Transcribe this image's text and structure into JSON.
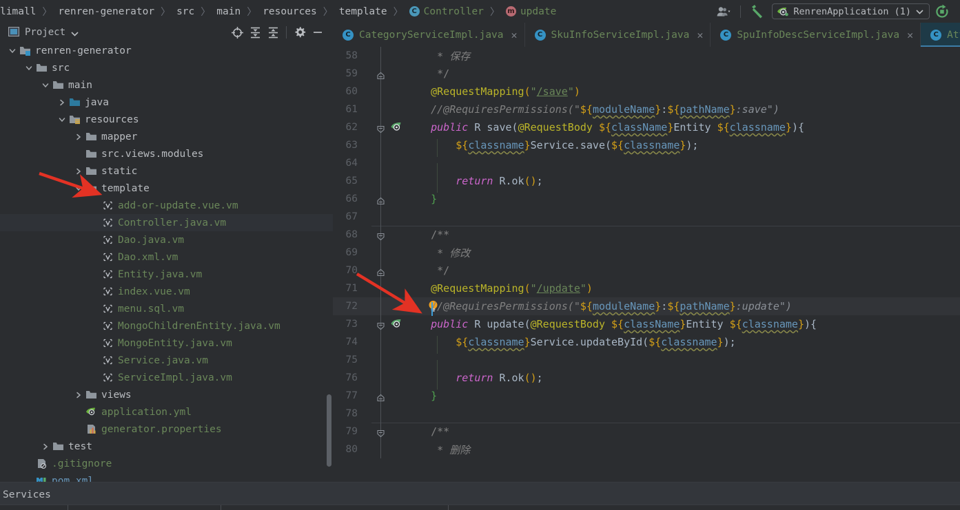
{
  "breadcrumb": [
    {
      "label": "limall",
      "type": "text"
    },
    {
      "label": "renren-generator",
      "type": "text"
    },
    {
      "label": "src",
      "type": "text"
    },
    {
      "label": "main",
      "type": "text"
    },
    {
      "label": "resources",
      "type": "text"
    },
    {
      "label": "template",
      "type": "text"
    },
    {
      "label": "Controller",
      "type": "class",
      "badge": "C"
    },
    {
      "label": "update",
      "type": "method",
      "badge": "m"
    }
  ],
  "toolbar": {
    "user_icon": "user-account-icon",
    "build_icon": "build-hammer-icon",
    "run_config": "RenrenApplication (1)",
    "run_config_icon": "spring-boot-leaf-icon",
    "dropdown_icon": "chevron-down-icon",
    "rerun_icon": "rerun-icon"
  },
  "project_panel": {
    "title": "Project",
    "dropdown_icon": "chevron-down-icon",
    "window_icon": "project-window-icon",
    "tools": [
      "locate-target-icon",
      "expand-all-icon",
      "collapse-all-icon",
      "settings-gear-icon",
      "minimize-icon"
    ]
  },
  "tree": [
    {
      "label": "renren-generator",
      "indent": 1,
      "arrow": "down",
      "icon": "module-folder",
      "color": "default"
    },
    {
      "label": "src",
      "indent": 2,
      "arrow": "down",
      "icon": "folder",
      "color": "default"
    },
    {
      "label": "main",
      "indent": 3,
      "arrow": "down",
      "icon": "folder",
      "color": "default"
    },
    {
      "label": "java",
      "indent": 4,
      "arrow": "right",
      "icon": "folder-source",
      "color": "default"
    },
    {
      "label": "resources",
      "indent": 4,
      "arrow": "down",
      "icon": "folder-resource",
      "color": "default"
    },
    {
      "label": "mapper",
      "indent": 5,
      "arrow": "right",
      "icon": "folder",
      "color": "default"
    },
    {
      "label": "src.views.modules",
      "indent": 5,
      "arrow": "none",
      "icon": "folder",
      "color": "default"
    },
    {
      "label": "static",
      "indent": 5,
      "arrow": "right",
      "icon": "folder",
      "color": "default"
    },
    {
      "label": "template",
      "indent": 5,
      "arrow": "down",
      "icon": "folder",
      "color": "default"
    },
    {
      "label": "add-or-update.vue.vm",
      "indent": 6,
      "arrow": "none",
      "icon": "velocity-file",
      "color": "green"
    },
    {
      "label": "Controller.java.vm",
      "indent": 6,
      "arrow": "none",
      "icon": "velocity-file",
      "color": "green",
      "selected": true
    },
    {
      "label": "Dao.java.vm",
      "indent": 6,
      "arrow": "none",
      "icon": "velocity-file",
      "color": "green"
    },
    {
      "label": "Dao.xml.vm",
      "indent": 6,
      "arrow": "none",
      "icon": "velocity-file",
      "color": "green"
    },
    {
      "label": "Entity.java.vm",
      "indent": 6,
      "arrow": "none",
      "icon": "velocity-file",
      "color": "green"
    },
    {
      "label": "index.vue.vm",
      "indent": 6,
      "arrow": "none",
      "icon": "velocity-file",
      "color": "green"
    },
    {
      "label": "menu.sql.vm",
      "indent": 6,
      "arrow": "none",
      "icon": "velocity-file",
      "color": "green"
    },
    {
      "label": "MongoChildrenEntity.java.vm",
      "indent": 6,
      "arrow": "none",
      "icon": "velocity-file",
      "color": "green"
    },
    {
      "label": "MongoEntity.java.vm",
      "indent": 6,
      "arrow": "none",
      "icon": "velocity-file",
      "color": "green"
    },
    {
      "label": "Service.java.vm",
      "indent": 6,
      "arrow": "none",
      "icon": "velocity-file",
      "color": "green"
    },
    {
      "label": "ServiceImpl.java.vm",
      "indent": 6,
      "arrow": "none",
      "icon": "velocity-file",
      "color": "green"
    },
    {
      "label": "views",
      "indent": 5,
      "arrow": "right",
      "icon": "folder",
      "color": "default"
    },
    {
      "label": "application.yml",
      "indent": 5,
      "arrow": "none",
      "icon": "spring-yml",
      "color": "green"
    },
    {
      "label": "generator.properties",
      "indent": 5,
      "arrow": "none",
      "icon": "properties",
      "color": "green"
    },
    {
      "label": "test",
      "indent": 3,
      "arrow": "right",
      "icon": "folder",
      "color": "default"
    },
    {
      "label": ".gitignore",
      "indent": 2,
      "arrow": "none",
      "icon": "gitignore",
      "color": "green"
    },
    {
      "label": "pom.xml",
      "indent": 2,
      "arrow": "none",
      "icon": "maven",
      "color": "blue"
    }
  ],
  "tabs": [
    {
      "label": "CategoryServiceImpl.java",
      "icon": "java-class-icon",
      "closable": true,
      "active": false
    },
    {
      "label": "SkuInfoServiceImpl.java",
      "icon": "java-class-icon",
      "closable": true,
      "active": false
    },
    {
      "label": "SpuInfoDescServiceImpl.java",
      "icon": "java-class-icon",
      "closable": true,
      "active": false
    },
    {
      "label": "AttrAttrgroupRelationServic",
      "icon": "java-class-icon",
      "closable": false,
      "active": true
    }
  ],
  "code_lines": [
    {
      "num": "58",
      "fold": "none",
      "html": "<span class='cmtb'>     * </span><span class='cmt'>保存</span>"
    },
    {
      "num": "59",
      "fold": "end",
      "html": "<span class='cmtb'>     */</span>"
    },
    {
      "num": "60",
      "fold": "none",
      "html": "<span class='anno'>    @RequestMapping</span><span class='paren'>(</span><span class='str'>\"</span><span class='strl'>/save</span><span class='str'>\"</span><span class='paren'>)</span>"
    },
    {
      "num": "61",
      "fold": "none",
      "html": "<span class='cmt'>    //@RequiresPermissions(\"</span><span class='brace'>${</span><span class='vel'>moduleName</span><span class='brace'>}</span><span class='plain'>:</span><span class='brace'>${</span><span class='vel'>pathName</span><span class='brace'>}</span><span class='vstr'>:save\")</span>"
    },
    {
      "num": "62",
      "fold": "start",
      "bean": true,
      "html": "<span class='kwv'>    public </span><span class='plain'>R save(</span><span class='anno'>@RequestBody </span><span class='brace'>${</span><span class='vel'>className</span><span class='brace'>}</span><span class='plain'>Entity </span><span class='brace'>${</span><span class='vel'>classname</span><span class='brace'>}</span><span class='plain'>){</span>"
    },
    {
      "num": "63",
      "fold": "none",
      "indentline": true,
      "html": "<span class='plain'>        </span><span class='brace'>${</span><span class='vel'>classname</span><span class='brace'>}</span><span class='plain'>Service.save(</span><span class='brace'>${</span><span class='vel'>classname</span><span class='brace'>}</span><span class='plain'>);</span>"
    },
    {
      "num": "64",
      "fold": "none",
      "indentline": true,
      "html": ""
    },
    {
      "num": "65",
      "fold": "none",
      "indentline": true,
      "html": "<span class='kwv'>        return </span><span class='plain'>R.ok</span><span class='paren'>()</span><span class='plain'>;</span>"
    },
    {
      "num": "66",
      "fold": "end",
      "html": "<span class='gbrace'>    }</span>"
    },
    {
      "num": "67",
      "fold": "none",
      "html": ""
    },
    {
      "num": "68",
      "fold": "start",
      "sep": true,
      "html": "<span class='cmtb'>    /**</span>"
    },
    {
      "num": "69",
      "fold": "none",
      "html": "<span class='cmtb'>     * </span><span class='cmt'>修改</span>"
    },
    {
      "num": "70",
      "fold": "end",
      "html": "<span class='cmtb'>     */</span>"
    },
    {
      "num": "71",
      "fold": "none",
      "html": "<span class='anno'>    @RequestMapping</span><span class='paren'>(</span><span class='str'>\"</span><span class='strl'>/update</span><span class='str'>\"</span><span class='paren'>)</span>"
    },
    {
      "num": "72",
      "fold": "none",
      "hl": true,
      "bulb": true,
      "caret": true,
      "html": "<span class='cmt'>    //@RequiresPermissions(\"</span><span class='brace'>${</span><span class='vel'>moduleName</span><span class='brace'>}</span><span class='plain'>:</span><span class='brace'>${</span><span class='vel'>pathName</span><span class='brace'>}</span><span class='vstr'>:update\")</span>"
    },
    {
      "num": "73",
      "fold": "start",
      "bean": true,
      "html": "<span class='kwv'>    public </span><span class='plain'>R update(</span><span class='anno'>@RequestBody </span><span class='brace'>${</span><span class='vel'>className</span><span class='brace'>}</span><span class='plain'>Entity </span><span class='brace'>${</span><span class='vel'>classname</span><span class='brace'>}</span><span class='plain'>){</span>"
    },
    {
      "num": "74",
      "fold": "none",
      "indentline": true,
      "html": "<span class='plain'>        </span><span class='brace'>${</span><span class='vel'>classname</span><span class='brace'>}</span><span class='plain'>Service.updateById(</span><span class='brace'>${</span><span class='vel'>classname</span><span class='brace'>}</span><span class='plain'>);</span>"
    },
    {
      "num": "75",
      "fold": "none",
      "indentline": true,
      "html": ""
    },
    {
      "num": "76",
      "fold": "none",
      "indentline": true,
      "html": "<span class='kwv'>        return </span><span class='plain'>R.ok</span><span class='paren'>()</span><span class='plain'>;</span>"
    },
    {
      "num": "77",
      "fold": "end",
      "html": "<span class='gbrace'>    }</span>"
    },
    {
      "num": "78",
      "fold": "none",
      "html": ""
    },
    {
      "num": "79",
      "fold": "start",
      "sep": true,
      "html": "<span class='cmtb'>    /**</span>"
    },
    {
      "num": "80",
      "fold": "none",
      "html": "<span class='cmtb'>     * </span><span class='cmt'>删除</span>"
    }
  ],
  "status_bar": {
    "services_label": "Services"
  },
  "annotations": {
    "arrow1": "red-arrow-pointing-to-template-folder",
    "arrow2": "red-arrow-pointing-to-line-72"
  },
  "colors": {
    "background": "#2b2d30",
    "panel": "#2b2d30",
    "tab_active": "#1e3a47",
    "accent_blue": "#3592c4",
    "string_green": "#6a8759",
    "annotation_yellow": "#bbb529",
    "velocity_brace": "#d4a017",
    "velocity_var": "#6897bb",
    "keyword_purple": "#cc66cc",
    "arrow_red": "#e33224",
    "line_highlight": "#323438"
  }
}
